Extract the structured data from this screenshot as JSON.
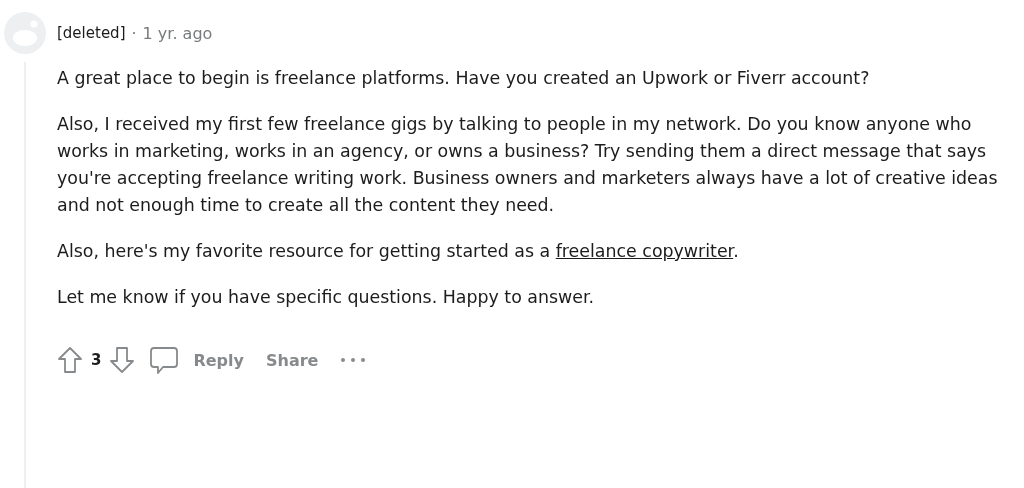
{
  "comment": {
    "author": "[deleted]",
    "separator": "·",
    "time": "1 yr. ago",
    "paragraphs": [
      {
        "text": "A great place to begin is freelance platforms. Have you created an Upwork or Fiverr account?"
      },
      {
        "text": "Also, I received my first few freelance gigs by talking to people in my network. Do you know anyone who works in marketing, works in an agency, or owns a business? Try sending them a direct message that says you're accepting freelance writing work. Business owners and marketers always have a lot of creative ideas and not enough time to create all the content they need."
      },
      {
        "text": "Also, here's my favorite resource for getting started as a ",
        "link": "freelance copywriter",
        "after": "."
      },
      {
        "text": "Let me know if you have specific questions. Happy to answer."
      }
    ],
    "votes": "3",
    "actions": [
      "Reply",
      "Share"
    ]
  }
}
